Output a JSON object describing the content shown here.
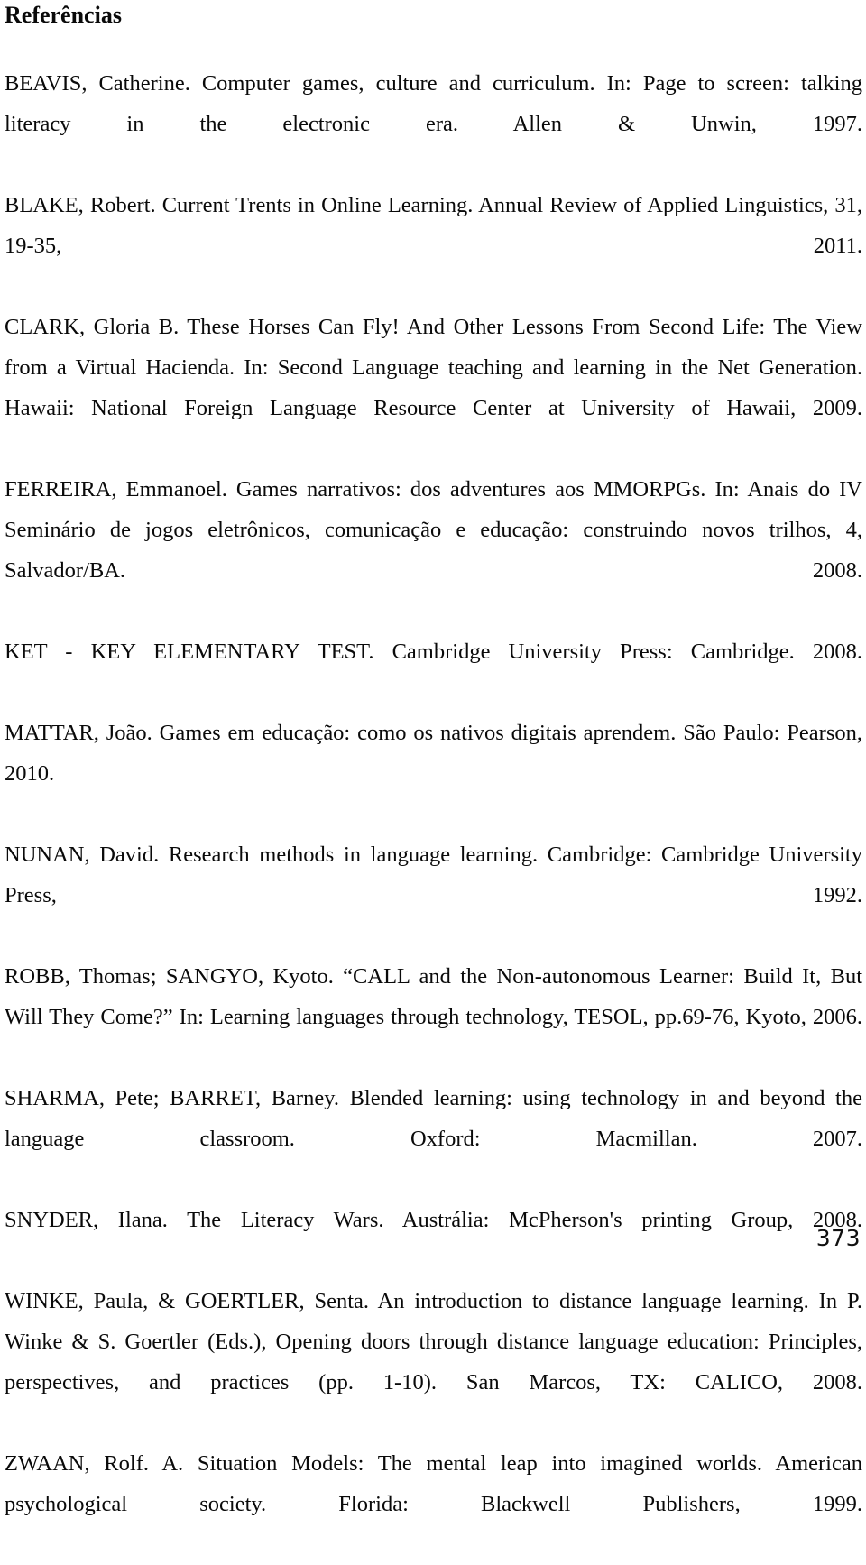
{
  "document": {
    "heading": "Referências",
    "page_number": "373",
    "references": [
      {
        "id": "beavis",
        "text": "BEAVIS, Catherine. Computer games, culture and curriculum. In: Page to screen: talking literacy in the electronic era.  Allen & Unwin, 1997."
      },
      {
        "id": "blake",
        "text": "BLAKE, Robert. Current Trents in Online Learning. Annual Review of Applied Linguistics, 31, 19-35, 2011."
      },
      {
        "id": "clark",
        "text": "CLARK, Gloria B. These Horses Can Fly! And Other Lessons From Second Life: The View from a Virtual Hacienda. In: Second Language teaching and learning in the Net Generation. Hawaii: National Foreign Language Resource Center at University of Hawaii, 2009."
      },
      {
        "id": "ferreira",
        "text": "FERREIRA, Emmanoel. Games narrativos: dos adventures aos MMORPGs.  In: Anais do IV Seminário de jogos eletrônicos, comunicação e educação: construindo novos trilhos, 4, Salvador/BA. 2008."
      },
      {
        "id": "ket",
        "text": "KET - KEY ELEMENTARY TEST. Cambridge University Press: Cambridge. 2008."
      },
      {
        "id": "mattar",
        "text": "MATTAR, João. Games em educação: como os nativos digitais aprendem. São Paulo: Pearson, 2010."
      },
      {
        "id": "nunan",
        "text": "NUNAN, David. Research methods in language learning. Cambridge: Cambridge University Press, 1992."
      },
      {
        "id": "robb",
        "text": "ROBB, Thomas; SANGYO, Kyoto. “CALL and the Non-autonomous Learner: Build It, But Will They Come?” In: Learning languages through technology, TESOL, pp.69-76, Kyoto, 2006."
      },
      {
        "id": "sharma",
        "text": "SHARMA, Pete; BARRET, Barney. Blended learning: using technology in and beyond the language classroom. Oxford: Macmillan. 2007."
      },
      {
        "id": "snyder",
        "text": "SNYDER, Ilana. The Literacy Wars. Austrália: McPherson's printing Group, 2008."
      },
      {
        "id": "winke",
        "text": "WINKE, Paula, & GOERTLER, Senta. An introduction to distance language learning. In P. Winke & S. Goertler (Eds.), Opening doors through distance language education: Principles, perspectives, and practices (pp. 1-10). San Marcos, TX: CALICO, 2008."
      },
      {
        "id": "zwaan",
        "text": "ZWAAN, Rolf. A. Situation Models: The mental leap into imagined worlds. American psychological society. Florida: Blackwell Publishers, 1999."
      }
    ]
  }
}
